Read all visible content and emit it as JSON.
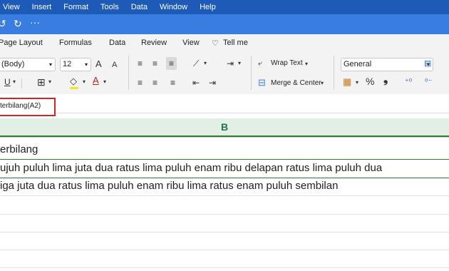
{
  "menubar": [
    "View",
    "Insert",
    "Format",
    "Tools",
    "Data",
    "Window",
    "Help"
  ],
  "qat": {
    "undo": "↺",
    "redo": "↻",
    "more": "···"
  },
  "tabs": [
    "Page Layout",
    "Formulas",
    "Data",
    "Review",
    "View",
    "Tell me"
  ],
  "ribbon": {
    "font_name": "(Body)",
    "font_size": "12",
    "font_grow": "A",
    "font_shrink": "A",
    "underline": "U",
    "font_color": "A",
    "wrap_text": "Wrap Text",
    "merge_center": "Merge & Center",
    "number_format": "General",
    "percent": "%",
    "comma": "❟"
  },
  "formula_bar": {
    "name_box": "terbilang(A2)"
  },
  "columns": [
    "B"
  ],
  "rows": [
    "erbilang",
    "ujuh puluh lima juta dua ratus lima puluh enam ribu delapan ratus lima puluh dua",
    "iga juta dua ratus lima puluh enam ribu lima ratus enam puluh sembilan",
    "",
    "",
    "",
    "",
    ""
  ],
  "colors": {
    "menubar": "#1e5bb8",
    "qat": "#3a7de0",
    "accent_green": "#217346",
    "highlight_red": "#d42424"
  }
}
